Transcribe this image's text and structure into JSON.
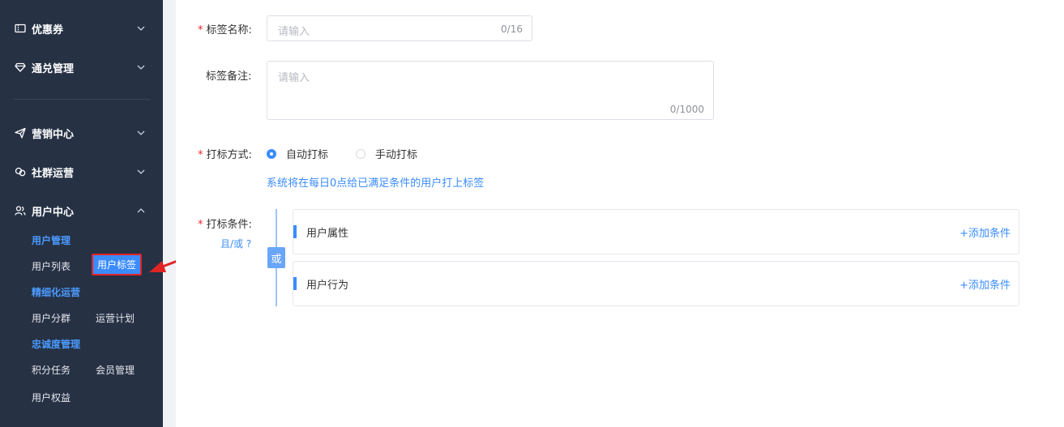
{
  "sidebar": {
    "menu": [
      {
        "label": "优惠券",
        "icon": "coupon-icon",
        "chevron": "down"
      },
      {
        "label": "通兑管理",
        "icon": "gem-icon",
        "chevron": "down"
      },
      {
        "label": "营销中心",
        "icon": "send-icon",
        "chevron": "down"
      },
      {
        "label": "社群运营",
        "icon": "community-icon",
        "chevron": "down"
      },
      {
        "label": "用户中心",
        "icon": "users-icon",
        "chevron": "up"
      }
    ],
    "user_center": {
      "group_user_manage": "用户管理",
      "user_list": "用户列表",
      "user_tags": "用户标签",
      "group_fine_ops": "精细化运营",
      "user_segments": "用户分群",
      "ops_plan": "运营计划",
      "group_loyalty": "忠诚度管理",
      "points_tasks": "积分任务",
      "member_manage": "会员管理",
      "user_benefits": "用户权益"
    }
  },
  "form": {
    "tag_name": {
      "label": "标签名称:",
      "placeholder": "请输入",
      "counter": "0/16"
    },
    "tag_note": {
      "label": "标签备注:",
      "placeholder": "请输入",
      "counter": "0/1000"
    },
    "tag_method": {
      "label": "打标方式:",
      "options": [
        {
          "label": "自动打标",
          "selected": true
        },
        {
          "label": "手动打标",
          "selected": false
        }
      ],
      "hint": "系统将在每日0点给已满足条件的用户打上标签"
    },
    "tag_condition": {
      "label": "打标条件:",
      "and_or": "且/或 ?",
      "or_badge": "或",
      "groups": [
        {
          "title": "用户属性",
          "add": "+添加条件"
        },
        {
          "title": "用户行为",
          "add": "+添加条件"
        }
      ]
    },
    "required_mark": "*"
  },
  "colors": {
    "sidebar_bg": "#263144",
    "accent": "#3b8cff",
    "highlight": "#e02424"
  }
}
